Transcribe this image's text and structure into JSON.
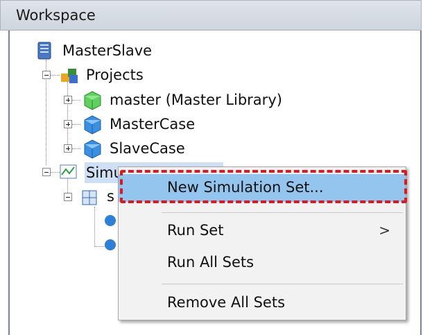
{
  "window": {
    "title": "Workspace"
  },
  "tree": {
    "root": "MasterSlave",
    "projects": "Projects",
    "project_items": [
      "master (Master Library)",
      "MasterCase",
      "SlaveCase"
    ],
    "simulation_sets_partial": "Simu",
    "set_partial": "s"
  },
  "context_menu": {
    "items": [
      {
        "label": "New Simulation Set..."
      },
      {
        "label": "Run Set",
        "submenu_arrow": ">"
      },
      {
        "label": "Run All Sets"
      },
      {
        "label": "Remove All Sets"
      }
    ]
  },
  "colors": {
    "highlight": "#93c5ee",
    "focus_dash": "#d81b23",
    "selection": "#cfe0f5"
  }
}
